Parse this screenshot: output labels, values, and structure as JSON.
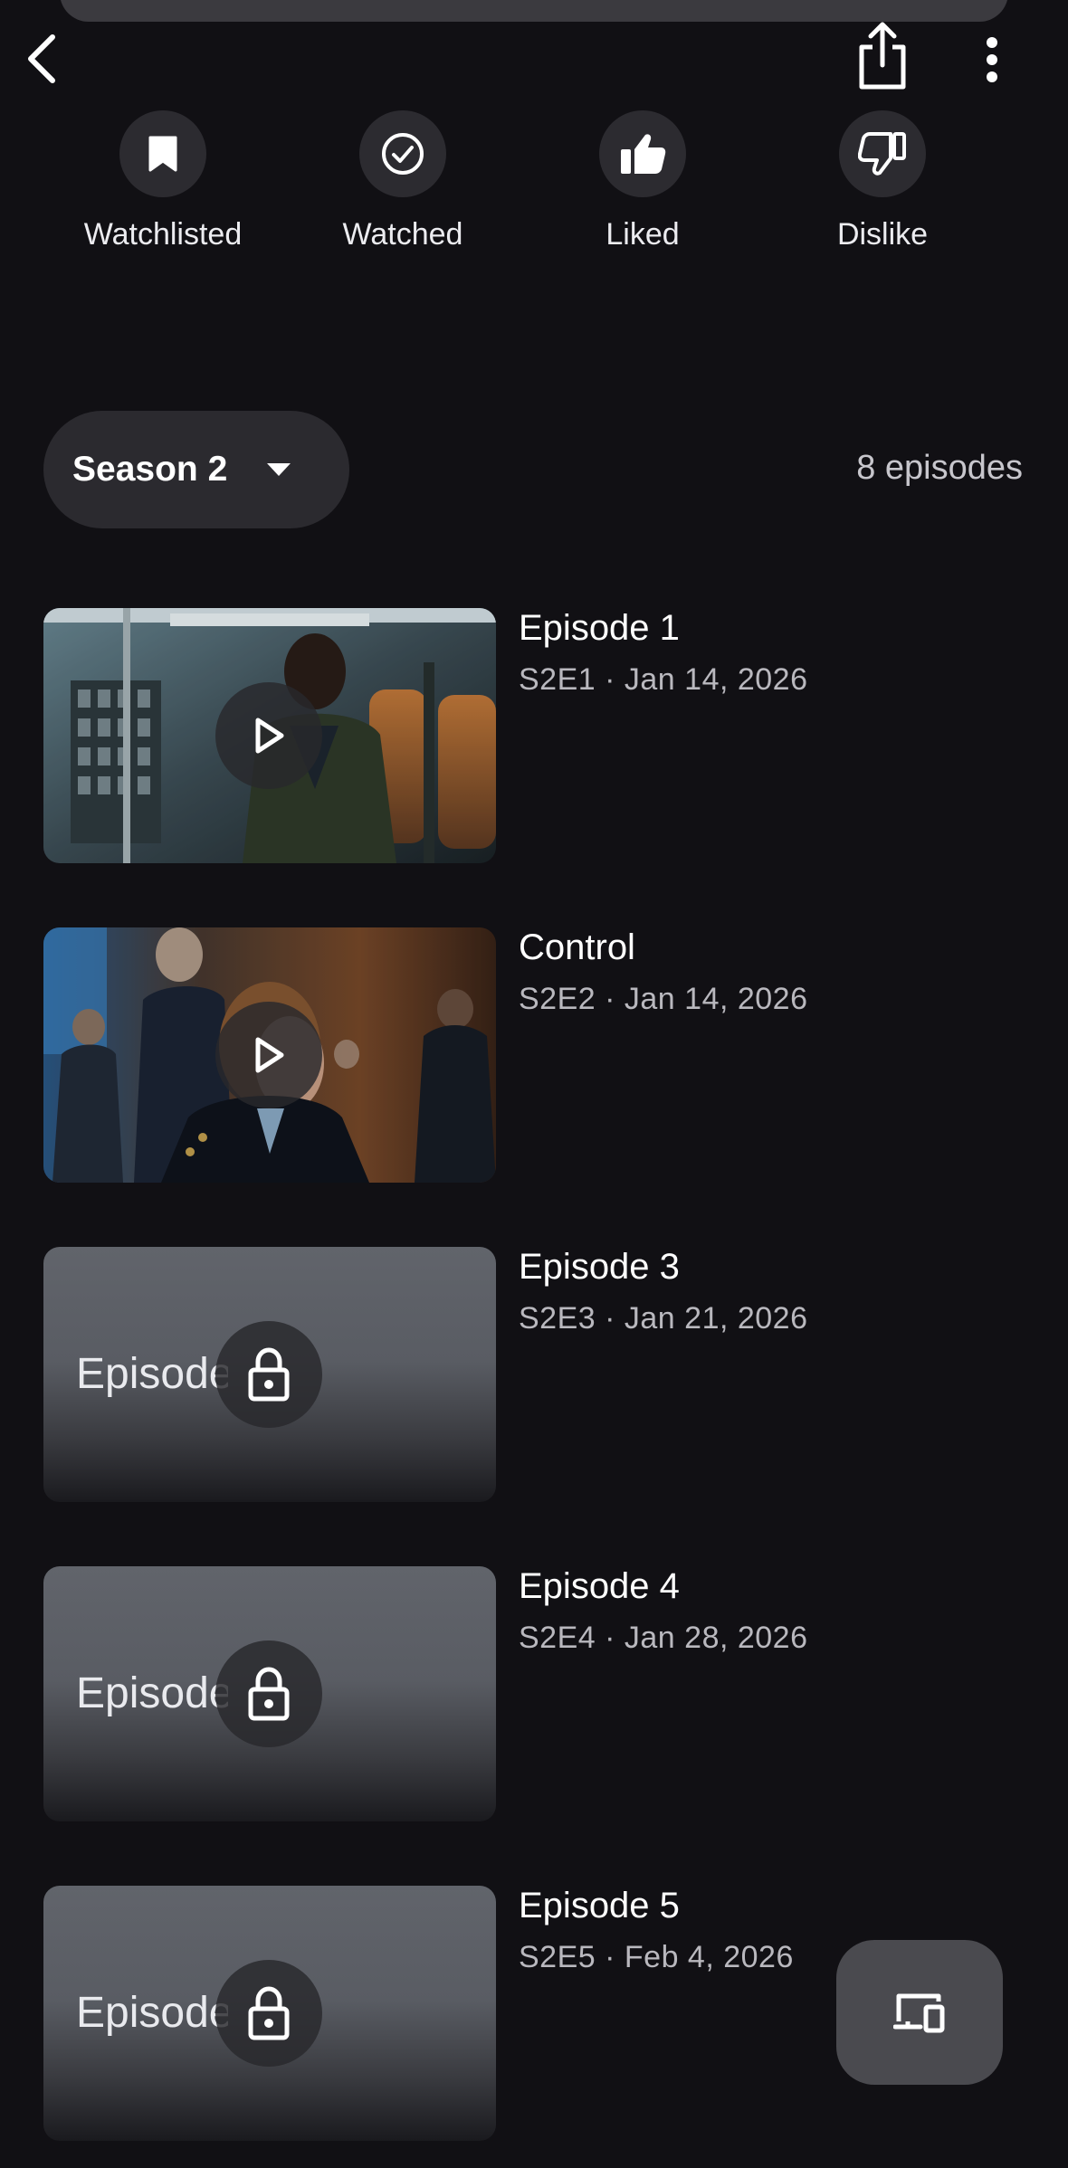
{
  "actions": {
    "watchlisted": "Watchlisted",
    "watched": "Watched",
    "liked": "Liked",
    "dislike": "Dislike"
  },
  "season": {
    "selected": "Season 2",
    "episode_count": "8 episodes"
  },
  "episodes": [
    {
      "title": "Episode 1",
      "meta": "S2E1 · Jan 14, 2026",
      "locked": false
    },
    {
      "title": "Control",
      "meta": "S2E2 · Jan 14, 2026",
      "locked": false
    },
    {
      "title": "Episode 3",
      "meta": "S2E3 · Jan 21, 2026",
      "locked": true,
      "thumb_text": "Episode"
    },
    {
      "title": "Episode 4",
      "meta": "S2E4 · Jan 28, 2026",
      "locked": true,
      "thumb_text": "Episode"
    },
    {
      "title": "Episode 5",
      "meta": "S2E5 · Feb 4, 2026",
      "locked": true,
      "thumb_text": "Episode"
    }
  ],
  "icons": {
    "back": "chevron-left-icon",
    "share": "share-icon",
    "more": "more-vertical-icon",
    "cast": "cast-icon"
  }
}
